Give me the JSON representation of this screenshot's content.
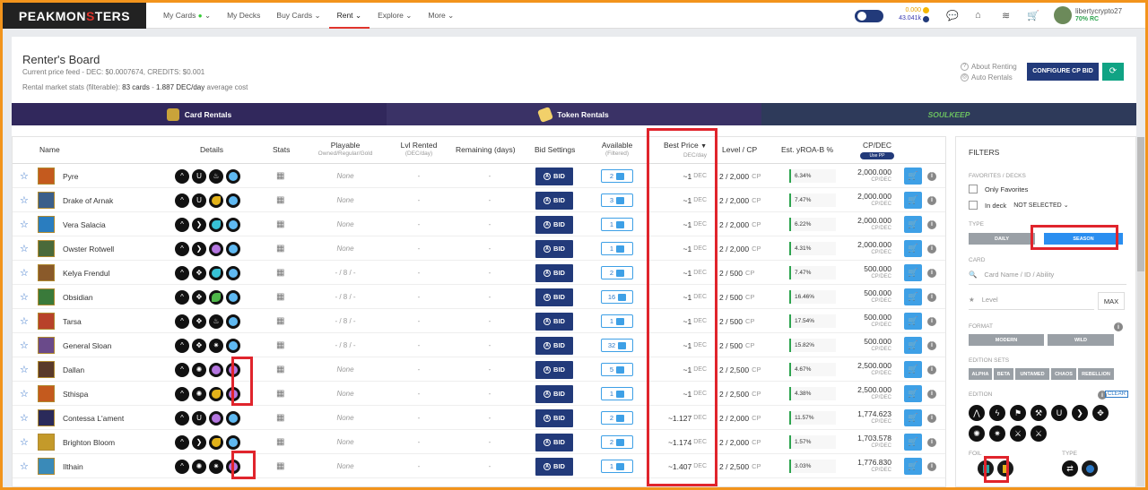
{
  "nav": {
    "logo_pre": "PEAKMON",
    "logo_mid": "S",
    "logo_post": "TERS",
    "items": [
      {
        "label": "My Cards",
        "dot": "●",
        "caret": "⌄"
      },
      {
        "label": "My Decks",
        "dot": "",
        "caret": ""
      },
      {
        "label": "Buy Cards",
        "dot": "",
        "caret": "⌄"
      },
      {
        "label": "Rent",
        "dot": "",
        "caret": "⌄"
      },
      {
        "label": "Explore",
        "dot": "",
        "caret": "⌄"
      },
      {
        "label": "More",
        "dot": "",
        "caret": "⌄"
      }
    ],
    "balance_dec": "0.000",
    "balance_credits": "43.041k",
    "username": "libertycrypto27",
    "rc": "70% RC"
  },
  "header": {
    "title": "Renter's Board",
    "price_feed": "Current price feed - DEC: $0.0007674, CREDITS: $0.001",
    "stats_label": "Rental market stats (filterable):",
    "stats_cards": "83 cards",
    "stats_sep": "-",
    "stats_cost": "1.887 DEC/day",
    "stats_suffix": "average cost",
    "about_renting": "About Renting",
    "auto_rentals": "Auto Rentals",
    "configure_btn": "CONFIGURE CP BID",
    "refresh_icon": "⟳"
  },
  "tabs": [
    {
      "label": "Card Rentals",
      "color": "#c9a33a"
    },
    {
      "label": "Token Rentals",
      "color": "#f2d06a"
    },
    {
      "label": "SOULKEEP",
      "color": "#6bbf60"
    }
  ],
  "table": {
    "headers": {
      "name": "Name",
      "details": "Details",
      "stats": "Stats",
      "playable": "Playable",
      "playable_sub": "Owned/Regular/Gold",
      "lvl_rented": "Lvl Rented",
      "lvl_rented_sub": "(DEC/day)",
      "remaining": "Remaining (days)",
      "bid_settings": "Bid Settings",
      "available": "Available",
      "available_sub": "(Filtered)",
      "best_price": "Best Price",
      "best_price_sub": "DEC/day",
      "level_cp": "Level / CP",
      "yroa": "Est. yROA-B %",
      "cpdec": "CP/DEC",
      "cpdec_toggle": "Use PP"
    },
    "bid_label": "BID",
    "dec_unit": "DEC",
    "cp_unit": "CP",
    "cpdec_unit": "CP/DEC",
    "rows": [
      {
        "name": "Pyre",
        "icons": [
          "^",
          "U",
          "♨",
          "c-lightblue"
        ],
        "playable": "None",
        "lvl": "-",
        "remaining": "-",
        "available": "2",
        "best": "~1",
        "level": "2 / 2,000",
        "roa": "6.34%",
        "cpdec": "2,000.000",
        "thumb": "#c45a1e"
      },
      {
        "name": "Drake of Arnak",
        "icons": [
          "^",
          "U",
          "c-gold",
          "c-lightblue"
        ],
        "playable": "None",
        "lvl": "-",
        "remaining": "-",
        "available": "3",
        "best": "~1",
        "level": "2 / 2,000",
        "roa": "7.47%",
        "cpdec": "2,000.000",
        "thumb": "#3b5f8a"
      },
      {
        "name": "Vera Salacia",
        "icons": [
          "^",
          "❯",
          "c-teal",
          "c-lightblue"
        ],
        "playable": "None",
        "lvl": "-",
        "remaining": "-",
        "available": "1",
        "best": "~1",
        "level": "2 / 2,000",
        "roa": "6.22%",
        "cpdec": "2,000.000",
        "thumb": "#2a7dbf"
      },
      {
        "name": "Owster Rotwell",
        "icons": [
          "^",
          "❯",
          "c-purple",
          "c-lightblue"
        ],
        "playable": "None",
        "lvl": "-",
        "remaining": "-",
        "available": "1",
        "best": "~1",
        "level": "2 / 2,000",
        "roa": "4.31%",
        "cpdec": "2,000.000",
        "thumb": "#4a6a3a"
      },
      {
        "name": "Kelya Frendul",
        "icons": [
          "^",
          "✥",
          "c-teal",
          "c-lightblue"
        ],
        "playable": "- / 8 / -",
        "lvl": "-",
        "remaining": "-",
        "available": "2",
        "best": "~1",
        "level": "2 / 500",
        "roa": "7.47%",
        "cpdec": "500.000",
        "thumb": "#8a5a2a"
      },
      {
        "name": "Obsidian",
        "icons": [
          "^",
          "✥",
          "c-green",
          "c-lightblue"
        ],
        "playable": "- / 8 / -",
        "lvl": "-",
        "remaining": "-",
        "available": "16",
        "best": "~1",
        "level": "2 / 500",
        "roa": "16.46%",
        "cpdec": "500.000",
        "thumb": "#3a7a3a"
      },
      {
        "name": "Tarsa",
        "icons": [
          "^",
          "✥",
          "♨",
          "c-lightblue"
        ],
        "playable": "- / 8 / -",
        "lvl": "-",
        "remaining": "-",
        "available": "1",
        "best": "~1",
        "level": "2 / 500",
        "roa": "17.54%",
        "cpdec": "500.000",
        "thumb": "#b8422a"
      },
      {
        "name": "General Sloan",
        "icons": [
          "^",
          "✥",
          "✷",
          "c-lightblue"
        ],
        "playable": "- / 8 / -",
        "lvl": "-",
        "remaining": "-",
        "available": "32",
        "best": "~1",
        "level": "2 / 500",
        "roa": "15.82%",
        "cpdec": "500.000",
        "thumb": "#6a4a8a"
      },
      {
        "name": "Dallan",
        "icons": [
          "^",
          "✺",
          "c-purple",
          "c-purple"
        ],
        "playable": "None",
        "lvl": "-",
        "remaining": "-",
        "available": "5",
        "best": "~1",
        "level": "2 / 2,500",
        "roa": "4.67%",
        "cpdec": "2,500.000",
        "thumb": "#5a3a2a"
      },
      {
        "name": "Sthispa",
        "icons": [
          "^",
          "✺",
          "c-gold",
          "c-purple"
        ],
        "playable": "None",
        "lvl": "-",
        "remaining": "-",
        "available": "1",
        "best": "~1",
        "level": "2 / 2,500",
        "roa": "4.38%",
        "cpdec": "2,500.000",
        "thumb": "#c45a1e"
      },
      {
        "name": "Contessa L'ament",
        "icons": [
          "^",
          "U",
          "c-purple",
          "c-lightblue"
        ],
        "playable": "None",
        "lvl": "-",
        "remaining": "-",
        "available": "2",
        "best": "~1.127",
        "level": "2 / 2,000",
        "roa": "11.57%",
        "cpdec": "1,774.623",
        "thumb": "#2a2a5a"
      },
      {
        "name": "Brighton Bloom",
        "icons": [
          "^",
          "❯",
          "c-gold",
          "c-lightblue"
        ],
        "playable": "None",
        "lvl": "-",
        "remaining": "-",
        "available": "2",
        "best": "~1.174",
        "level": "2 / 2,000",
        "roa": "1.57%",
        "cpdec": "1,703.578",
        "thumb": "#c49a2a"
      },
      {
        "name": "Ilthain",
        "icons": [
          "^",
          "✺",
          "✷",
          "c-purple"
        ],
        "playable": "None",
        "lvl": "-",
        "remaining": "-",
        "available": "1",
        "best": "~1.407",
        "level": "2 / 2,500",
        "roa": "3.03%",
        "cpdec": "1,776.830",
        "thumb": "#3a8ab8"
      }
    ]
  },
  "filters": {
    "title": "FILTERS",
    "favorites_label": "FAVORITES / DECKS",
    "only_favorites": "Only Favorites",
    "in_deck": "In deck",
    "in_deck_value": "NOT SELECTED",
    "type_label": "TYPE",
    "type_daily": "DAILY",
    "type_season": "SEASON",
    "card_label": "CARD",
    "card_placeholder": "Card Name / ID / Ability",
    "level_placeholder": "Level",
    "max_btn": "MAX",
    "format_label": "FORMAT",
    "format_modern": "MODERN",
    "format_wild": "WILD",
    "edition_sets_label": "EDITION SETS",
    "sets": [
      "ALPHA",
      "BETA",
      "UNTAMED",
      "CHAOS",
      "REBELLION"
    ],
    "edition_label": "EDITION",
    "clear": "CLEAR",
    "foil_label": "FOIL",
    "type2_label": "TYPE",
    "highlight_color": "#e0242c"
  }
}
